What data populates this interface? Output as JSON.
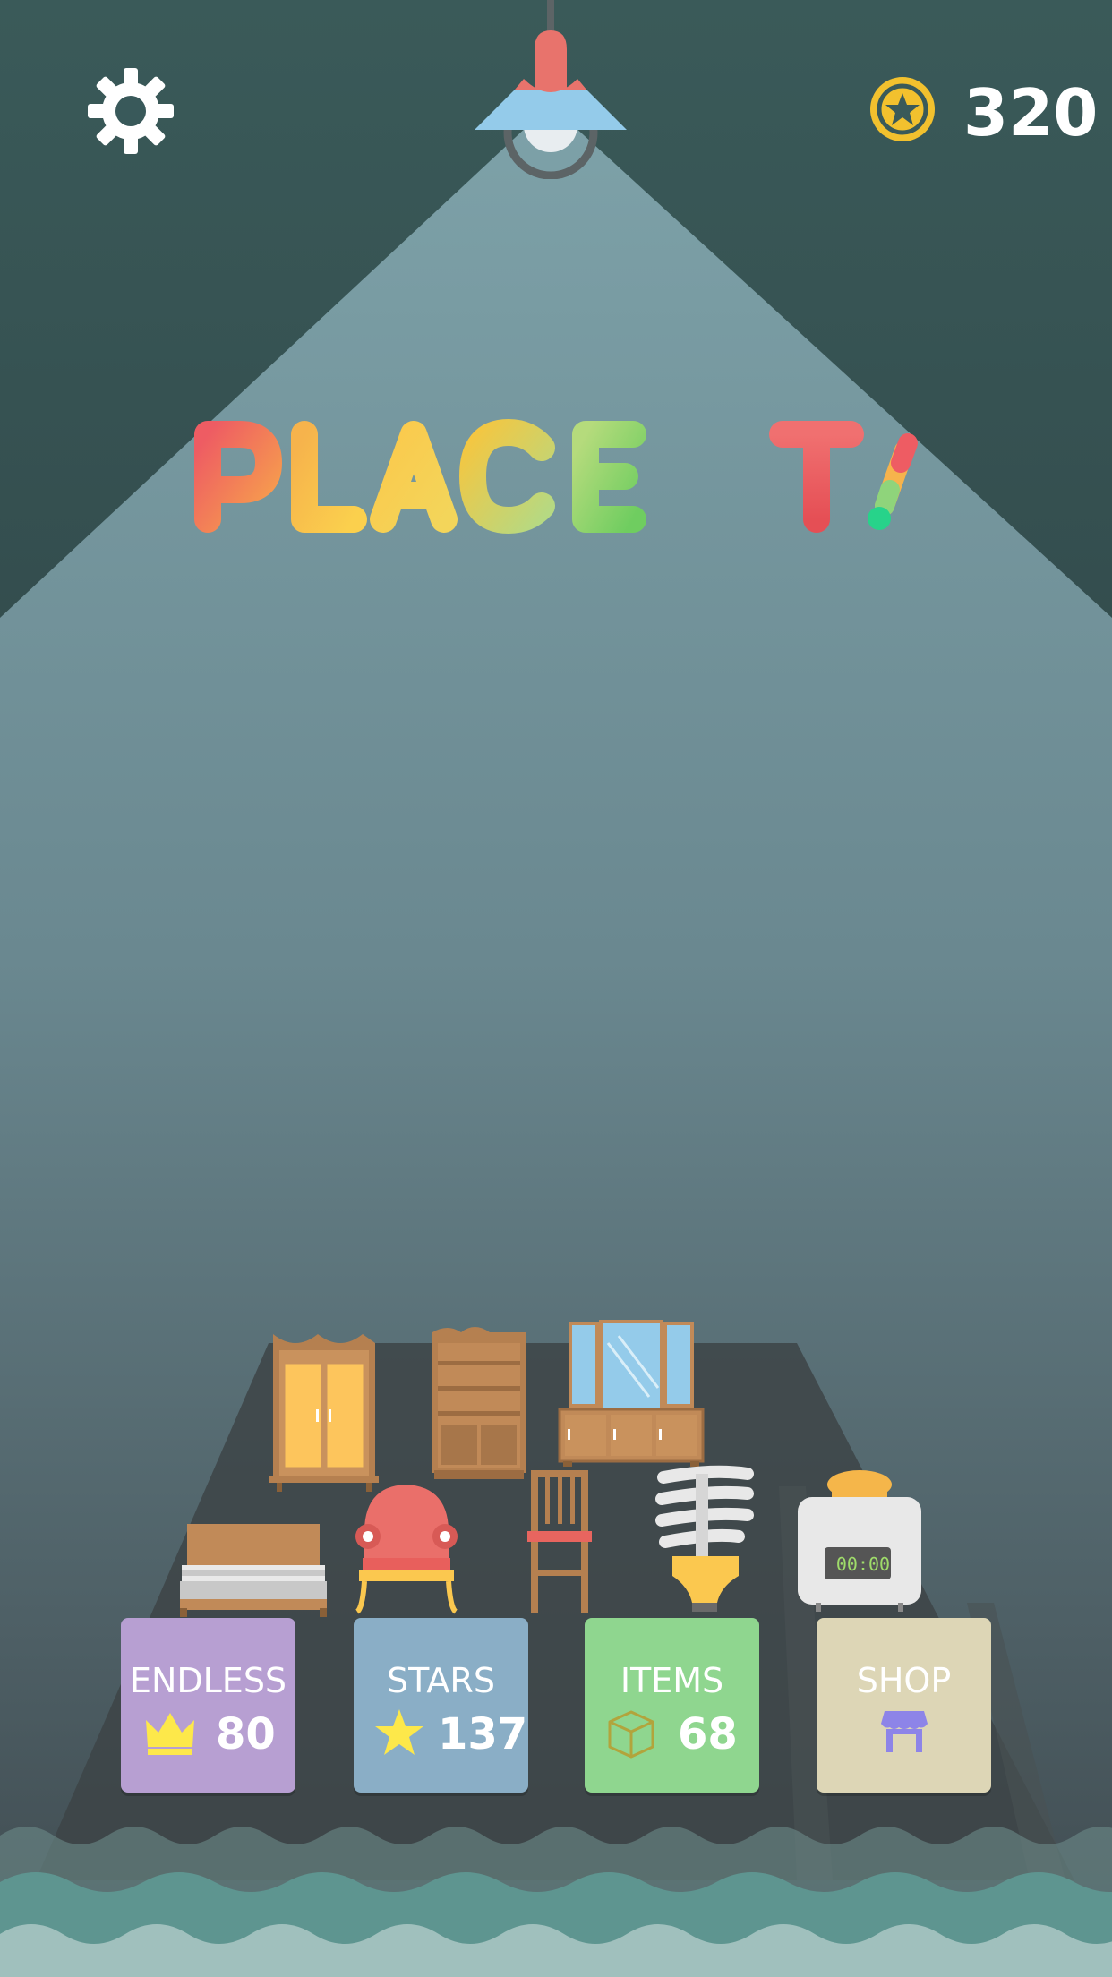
{
  "header": {
    "coins": "320"
  },
  "logo": {
    "title": "PLACE IT!"
  },
  "menu": {
    "endless": {
      "label": "ENDLESS",
      "value": "80",
      "color": "#b79fd2"
    },
    "stars": {
      "label": "STARS",
      "value": "137",
      "color": "#8aaec6"
    },
    "items": {
      "label": "ITEMS",
      "value": "68",
      "color": "#8fd68f"
    },
    "shop": {
      "label": "SHOP",
      "color": "#ddd6b6"
    }
  },
  "toaster": {
    "display": "00:00"
  },
  "icons": [
    "gear-icon",
    "star-coin-icon",
    "lamp-icon",
    "crown-icon",
    "star-icon",
    "cube-icon",
    "shop-icon"
  ]
}
